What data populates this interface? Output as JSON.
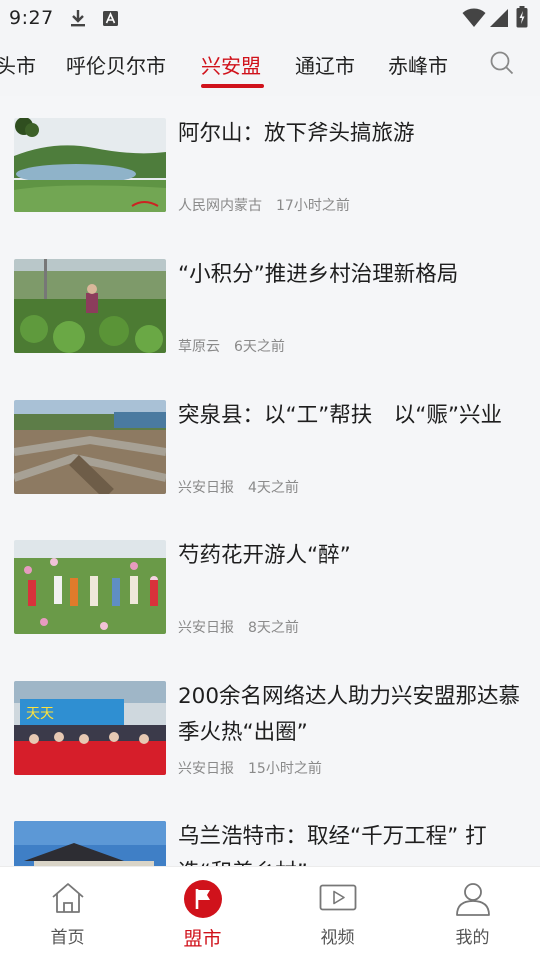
{
  "status_bar": {
    "time": "9:27"
  },
  "tabs": [
    {
      "label": "头市",
      "active": false
    },
    {
      "label": "呼伦贝尔市",
      "active": false
    },
    {
      "label": "兴安盟",
      "active": true
    },
    {
      "label": "通辽市",
      "active": false
    },
    {
      "label": "赤峰市",
      "active": false
    }
  ],
  "news": [
    {
      "title": "阿尔山：放下斧头搞旅游",
      "source": "人民网内蒙古",
      "time": "17小时之前"
    },
    {
      "title": "“小积分”推进乡村治理新格局",
      "source": "草原云",
      "time": "6天之前"
    },
    {
      "title": "突泉县：以“工”帮扶　以“赈”兴业",
      "source": "兴安日报",
      "time": "4天之前"
    },
    {
      "title": "芍药花开游人“醉”",
      "source": "兴安日报",
      "time": "8天之前"
    },
    {
      "title": "200余名网络达人助力兴安盟那达慕季火热“出圈”",
      "source": "兴安日报",
      "time": "15小时之前"
    },
    {
      "title": "乌兰浩特市：取经“千万工程” 打造“和美乡村”",
      "source": "",
      "time": ""
    }
  ],
  "bottom_nav": [
    {
      "label": "首页",
      "icon": "home-icon",
      "active": false
    },
    {
      "label": "盟市",
      "icon": "flag-icon",
      "active": true
    },
    {
      "label": "视频",
      "icon": "video-icon",
      "active": false
    },
    {
      "label": "我的",
      "icon": "user-icon",
      "active": false
    }
  ],
  "colors": {
    "accent": "#d0121b",
    "background": "#f4f5f7",
    "meta_text": "#8a8a8a"
  }
}
